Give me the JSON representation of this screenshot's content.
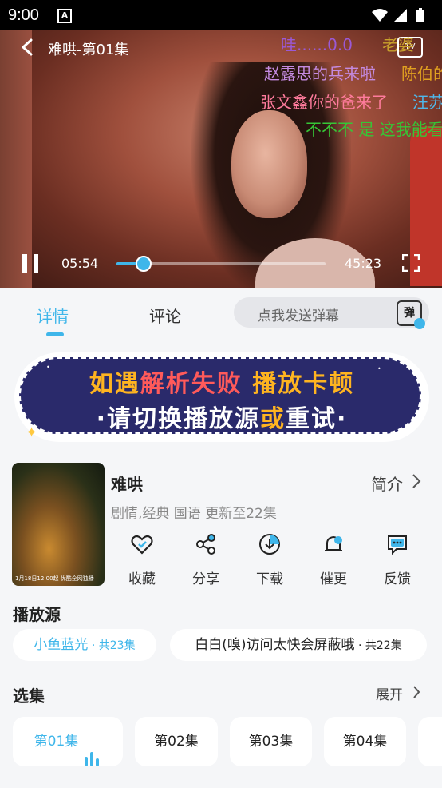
{
  "status_bar": {
    "time": "9:00",
    "notification_icon": "A"
  },
  "player": {
    "title": "难哄-第01集",
    "cast_icon_label": "TV",
    "current_time": "05:54",
    "total_time": "45:23",
    "progress": 0.13,
    "danmaku": [
      {
        "text": "哇......0.0",
        "color": "#9b59d6"
      },
      {
        "text": "老婆",
        "color": "#c9a22c"
      },
      {
        "text": "赵露思的兵来啦",
        "color": "#c48ae0"
      },
      {
        "text": "陈伯的",
        "color": "#e0a020"
      },
      {
        "text": "张文鑫你的爸来了",
        "color": "#ff7b9c"
      },
      {
        "text": "汪苏",
        "color": "#4fb8ea"
      },
      {
        "text": "不不不 是 这我能看",
        "color": "#36c636"
      }
    ]
  },
  "tabs": {
    "detail": "详情",
    "comment": "评论"
  },
  "danmu_input": {
    "placeholder": "点我发送弹幕",
    "button_label": "弹"
  },
  "banner": {
    "line1": [
      "如遇",
      "解析失败",
      " 播放卡顿"
    ],
    "line2": [
      "·请",
      "切换播放源",
      "或",
      "重试",
      "·"
    ]
  },
  "show": {
    "poster_caption": "1月18日12:00起 优酷全网独播",
    "name": "难哄",
    "intro_label": "简介",
    "meta": "剧情,经典 国语 更新至22集"
  },
  "actions": [
    {
      "label": "收藏",
      "icon": "heart-icon"
    },
    {
      "label": "分享",
      "icon": "share-icon"
    },
    {
      "label": "下载",
      "icon": "download-icon"
    },
    {
      "label": "催更",
      "icon": "bell-icon"
    },
    {
      "label": "反馈",
      "icon": "feedback-icon"
    }
  ],
  "sources_section": {
    "title": "播放源",
    "items": [
      {
        "name": "小鱼蓝光",
        "count": " · 共23集",
        "active": true
      },
      {
        "name": "白白(嗅)访问太快会屏蔽哦",
        "count": " · 共22集",
        "active": false
      }
    ]
  },
  "episodes_section": {
    "title": "选集",
    "expand_label": "展开",
    "items": [
      "第01集",
      "第02集",
      "第03集",
      "第04集"
    ]
  },
  "colors": {
    "accent": "#3fb6ea",
    "banner_bg": "#2a2a6b",
    "banner_yellow": "#ffb420",
    "banner_red": "#ff5a5a"
  }
}
